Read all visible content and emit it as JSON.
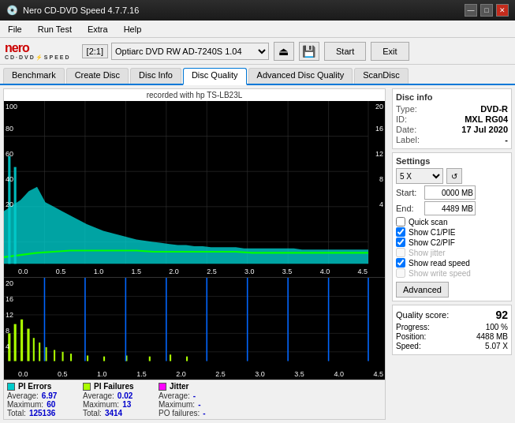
{
  "titlebar": {
    "title": "Nero CD-DVD Speed 4.7.7.16",
    "min_label": "—",
    "max_label": "□",
    "close_label": "✕"
  },
  "menubar": {
    "items": [
      "File",
      "Run Test",
      "Extra",
      "Help"
    ]
  },
  "toolbar": {
    "drive_badge": "[2:1]",
    "drive_name": "Optiarc DVD RW AD-7240S 1.04",
    "start_label": "Start",
    "exit_label": "Exit"
  },
  "tabs": {
    "items": [
      "Benchmark",
      "Create Disc",
      "Disc Info",
      "Disc Quality",
      "Advanced Disc Quality",
      "ScanDisc"
    ],
    "active": "Disc Quality"
  },
  "chart": {
    "header": "recorded with hp   TS-LB23L",
    "top_y_labels": [
      "100",
      "80",
      "60",
      "40",
      "20"
    ],
    "top_y_right": [
      "20",
      "16",
      "12",
      "8",
      "4"
    ],
    "bottom_y_labels": [
      "20",
      "16",
      "12",
      "8",
      "4"
    ],
    "x_labels": [
      "0.0",
      "0.5",
      "1.0",
      "1.5",
      "2.0",
      "2.5",
      "3.0",
      "3.5",
      "4.0",
      "4.5"
    ]
  },
  "stats": {
    "pi_errors": {
      "label": "PI Errors",
      "color": "#00ffff",
      "average_label": "Average:",
      "average_value": "6.97",
      "maximum_label": "Maximum:",
      "maximum_value": "60",
      "total_label": "Total:",
      "total_value": "125136"
    },
    "pi_failures": {
      "label": "PI Failures",
      "color": "#ffff00",
      "average_label": "Average:",
      "average_value": "0.02",
      "maximum_label": "Maximum:",
      "maximum_value": "13",
      "total_label": "Total:",
      "total_value": "3414"
    },
    "jitter": {
      "label": "Jitter",
      "color": "#ff00ff",
      "average_label": "Average:",
      "average_value": "-",
      "maximum_label": "Maximum:",
      "maximum_value": "-"
    },
    "po_failures": {
      "label": "PO failures:",
      "value": "-"
    }
  },
  "disc_info": {
    "title": "Disc info",
    "type_label": "Type:",
    "type_value": "DVD-R",
    "id_label": "ID:",
    "id_value": "MXL RG04",
    "date_label": "Date:",
    "date_value": "17 Jul 2020",
    "label_label": "Label:",
    "label_value": "-"
  },
  "settings": {
    "title": "Settings",
    "speed_value": "5 X",
    "start_label": "Start:",
    "start_value": "0000 MB",
    "end_label": "End:",
    "end_value": "4489 MB",
    "quick_scan_label": "Quick scan",
    "show_c1pie_label": "Show C1/PIE",
    "show_c2pif_label": "Show C2/PIF",
    "show_jitter_label": "Show jitter",
    "show_read_speed_label": "Show read speed",
    "show_write_speed_label": "Show write speed",
    "advanced_label": "Advanced"
  },
  "quality": {
    "score_label": "Quality score:",
    "score_value": "92",
    "progress_label": "Progress:",
    "progress_value": "100 %",
    "position_label": "Position:",
    "position_value": "4488 MB",
    "speed_label": "Speed:",
    "speed_value": "5.07 X"
  }
}
